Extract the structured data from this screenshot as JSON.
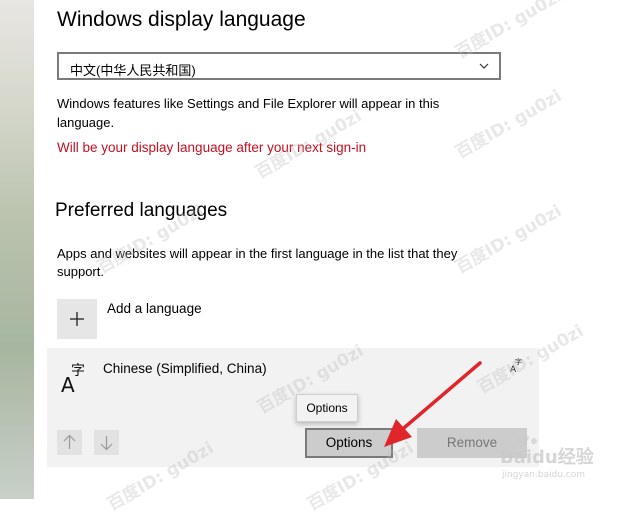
{
  "display_language": {
    "heading": "Windows display language",
    "selected": "中文(中华人民共和国)",
    "description": "Windows features like Settings and File Explorer will appear in this language.",
    "warning": "Will be your display language after your next sign-in"
  },
  "preferred_languages": {
    "heading": "Preferred languages",
    "description": "Apps and websites will appear in the first language in the list that they support.",
    "add_label": "Add a language",
    "items": [
      {
        "name": "Chinese (Simplified, China)",
        "icon": "language-icon",
        "badge_icon": "display-language-badge-icon"
      }
    ],
    "options_label": "Options",
    "remove_label": "Remove",
    "tooltip": "Options"
  },
  "watermark": {
    "text": "百度ID: gu0zi",
    "logo_text": "Baidu经验",
    "logo_url": "jingyan.baidu.com"
  },
  "colors": {
    "warning": "#c50f1f",
    "annotation_arrow": "#e0262b"
  }
}
